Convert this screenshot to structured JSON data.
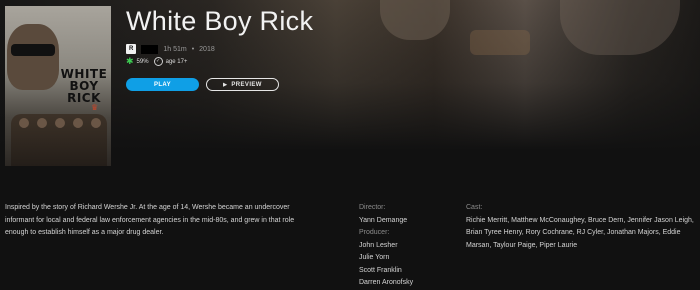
{
  "movie": {
    "title": "White Boy Rick",
    "rating": "R",
    "runtime": "1h 51m",
    "separator": "•",
    "year": "2018",
    "score": "59%",
    "age": "age 17+",
    "poster_title_lines": [
      "WHITE",
      "BOY",
      "RICK"
    ]
  },
  "buttons": {
    "play_label": "PLAY",
    "preview_label": "PREVIEW"
  },
  "synopsis": "Inspired by the story of Richard Wershe Jr. At the age of 14, Wershe became an undercover informant for local and federal law enforcement agencies in the mid-80s, and grew in that role enough to establish himself as a major drug dealer.",
  "credits": {
    "director_label": "Director:",
    "directors": [
      "Yann Demange"
    ],
    "producer_label": "Producer:",
    "producers": [
      "John Lesher",
      "Julie Yorn",
      "Scott Franklin",
      "Darren Aronofsky"
    ],
    "cast_label": "Cast:",
    "cast": "Richie Merritt, Matthew McConaughey, Bruce Dern, Jennifer Jason Leigh, Brian Tyree Henry, Rory Cochrane, RJ Cyler, Jonathan Majors, Eddie Marsan, Taylour Paige, Piper Laurie"
  },
  "colors": {
    "background": "#111111",
    "play_button": "#0f9fe6",
    "score_icon": "#3dcc52"
  },
  "icons": {
    "score": "splat-icon",
    "age": "check-circle-icon",
    "preview": "play-triangle-icon"
  }
}
